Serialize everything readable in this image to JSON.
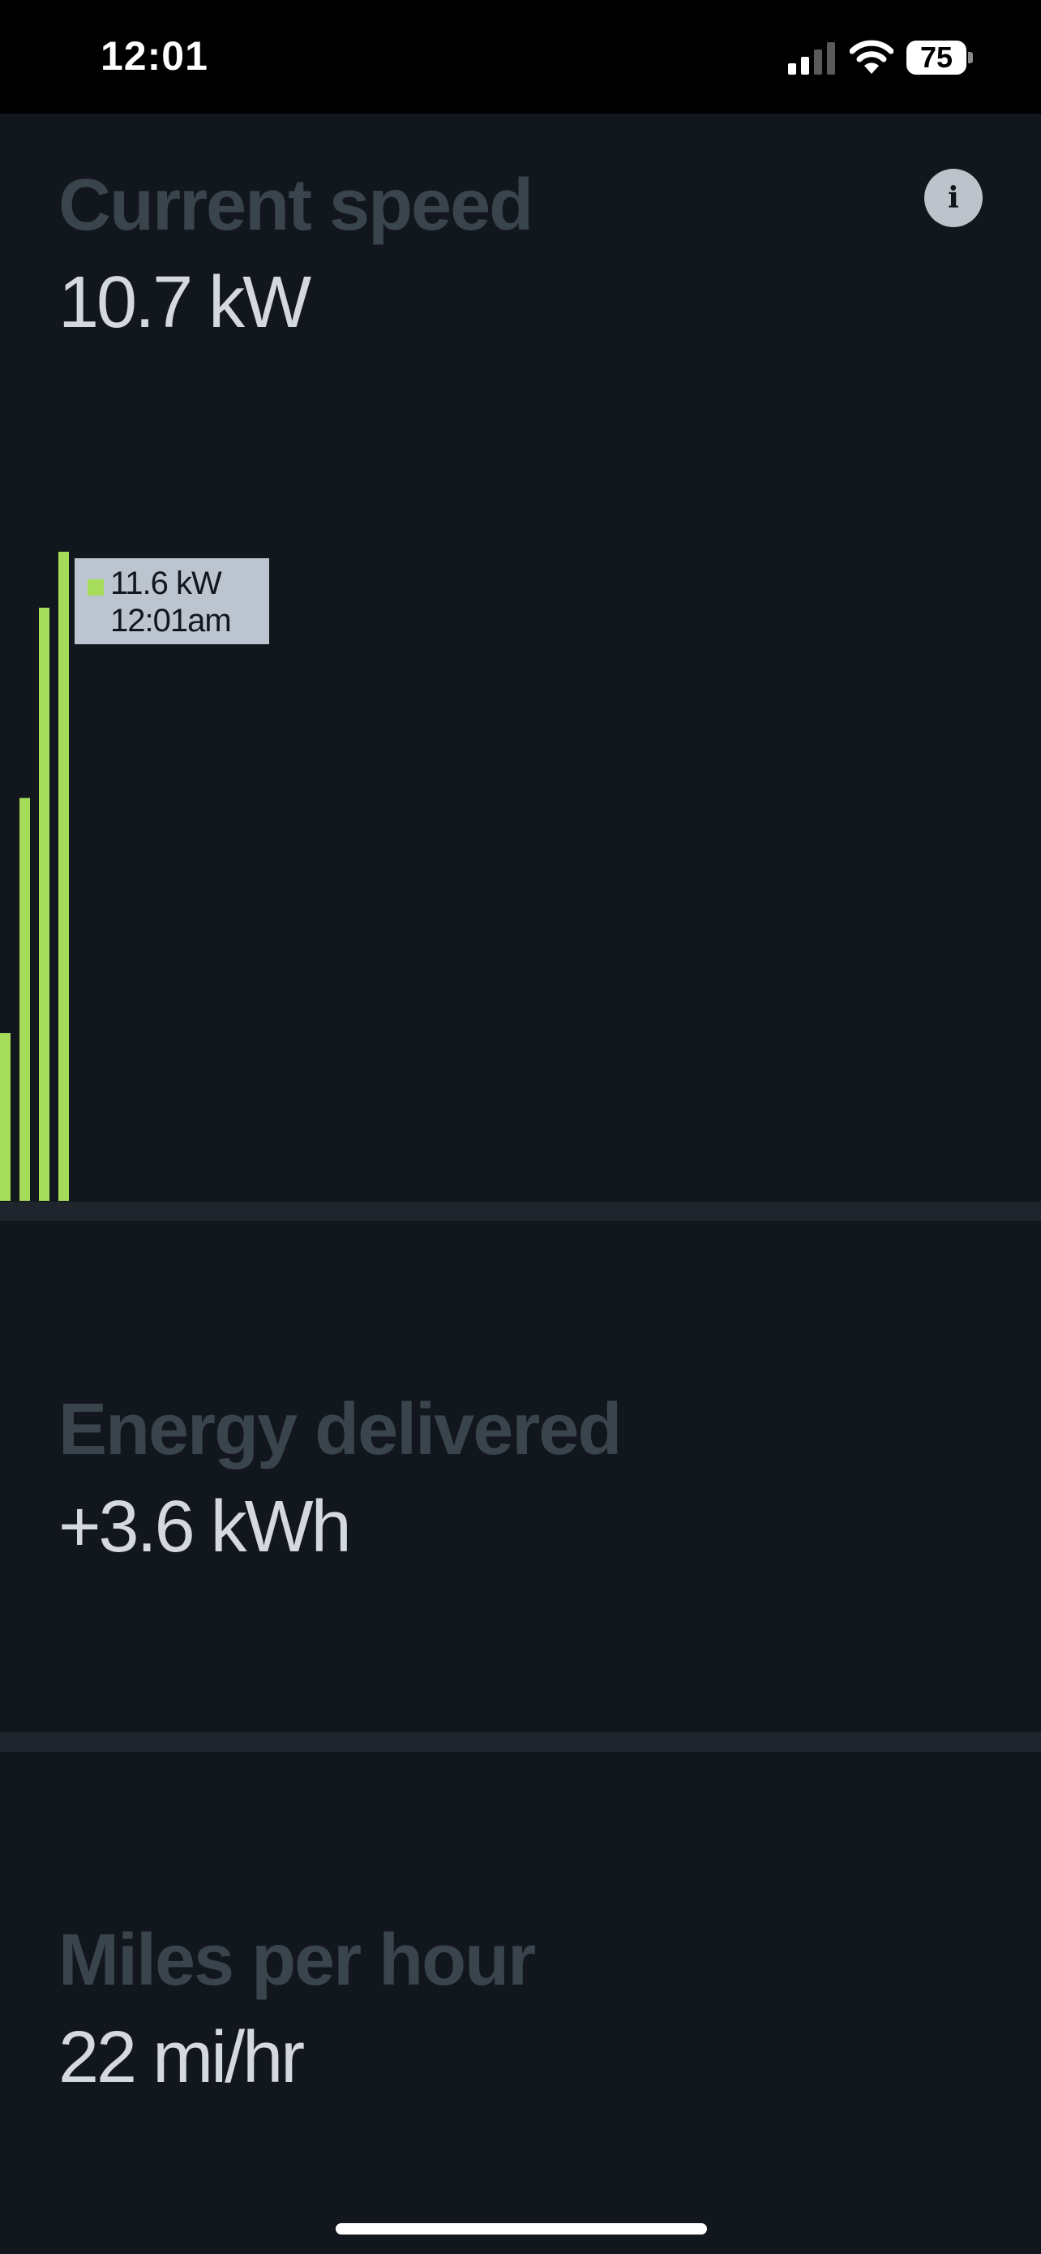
{
  "status_bar": {
    "time": "12:01",
    "battery": "75",
    "icons": [
      "signal-icon",
      "wifi-icon",
      "battery-icon"
    ]
  },
  "current_speed": {
    "label": "Current speed",
    "value": "10.7 kW",
    "info_icon": "i"
  },
  "chart_data": {
    "type": "bar",
    "color": "#a5dc5a",
    "unit": "kW",
    "ylim": [
      0,
      11.6
    ],
    "values": [
      3.0,
      7.2,
      10.6,
      11.6
    ],
    "tooltip": {
      "value": "11.6 kW",
      "time": "12:01am"
    }
  },
  "energy_delivered": {
    "label": "Energy delivered",
    "value": "+3.6 kWh"
  },
  "miles_per_hour": {
    "label": "Miles per hour",
    "value": "22 mi/hr"
  },
  "colors": {
    "background": "#12161d",
    "divider": "#1e252d",
    "label": "#3a444d",
    "value": "#d4d9de",
    "accent": "#a5dc5a"
  }
}
